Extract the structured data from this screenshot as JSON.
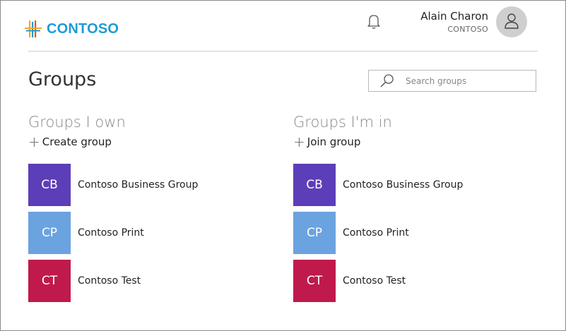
{
  "header": {
    "logo_text": "CONTOSO",
    "user": {
      "name": "Alain Charon",
      "org": "CONTOSO"
    }
  },
  "page": {
    "title": "Groups",
    "search_placeholder": "Search groups"
  },
  "sections": {
    "own": {
      "title": "Groups I own",
      "action_label": "Create group",
      "groups": [
        {
          "initials": "CB",
          "name": "Contoso Business Group",
          "color": "#5c3eb8"
        },
        {
          "initials": "CP",
          "name": "Contoso Print",
          "color": "#6aa3e0"
        },
        {
          "initials": "CT",
          "name": "Contoso Test",
          "color": "#bf1a4b"
        }
      ]
    },
    "member": {
      "title": "Groups I'm in",
      "action_label": "Join group",
      "groups": [
        {
          "initials": "CB",
          "name": "Contoso Business Group",
          "color": "#5c3eb8"
        },
        {
          "initials": "CP",
          "name": "Contoso Print",
          "color": "#6aa3e0"
        },
        {
          "initials": "CT",
          "name": "Contoso Test",
          "color": "#bf1a4b"
        }
      ]
    }
  },
  "icons": {
    "logo": "contoso-logo-icon",
    "bell": "bell-icon",
    "avatar": "user-avatar-icon",
    "search": "search-icon",
    "plus": "plus-icon"
  }
}
